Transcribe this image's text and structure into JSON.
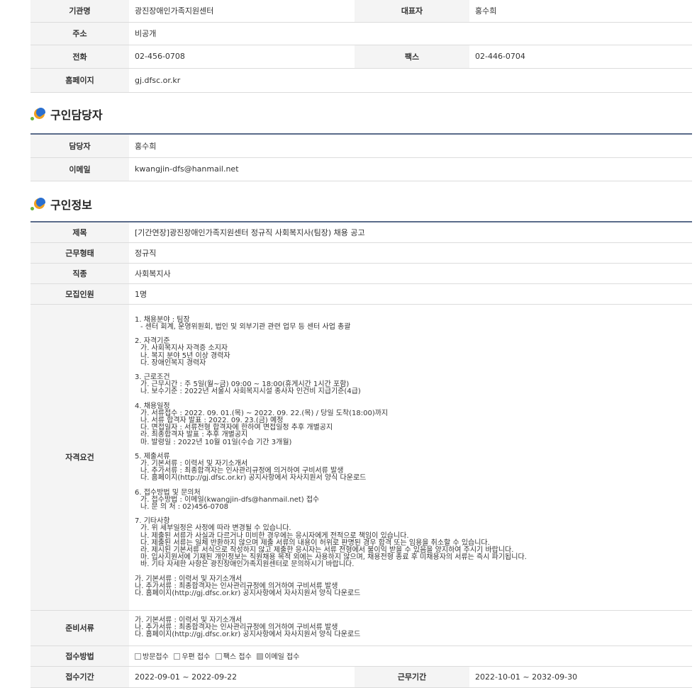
{
  "org": {
    "rows": [
      {
        "label": "기관명",
        "value": "광진장애인가족지원센터",
        "label2": "대표자",
        "value2": "홍수희"
      },
      {
        "label": "주소",
        "value": "비공개"
      },
      {
        "label": "전화",
        "value": "02-456-0708",
        "label2": "팩스",
        "value2": "02-446-0704"
      },
      {
        "label": "홈페이지",
        "value": "gj.dfsc.or.kr"
      }
    ]
  },
  "contact": {
    "section_title": "구인담당자",
    "rows": [
      {
        "label": "담당자",
        "value": "홍수희"
      },
      {
        "label": "이메일",
        "value": "kwangjin-dfs@hanmail.net"
      }
    ]
  },
  "job": {
    "section_title": "구인정보",
    "title_label": "제목",
    "title_value": "[기간연장]광진장애인가족지원센터 정규직 사회복지사(팀장) 채용 공고",
    "type_label": "근무형태",
    "type_value": "정규직",
    "kind_label": "직종",
    "kind_value": "사회복지사",
    "count_label": "모집인원",
    "count_value": "1명",
    "req_label": "자격요건",
    "requirements": [
      {
        "lines": [
          "1. 채용분야 : 팀장",
          "- 센터 회계, 운영위원회, 법인 및 외부기관 관련 업무 등 센터 사업 총괄"
        ]
      },
      {
        "lines": [
          "2. 자격기준",
          "가. 사회복지사 자격증 소지자",
          "나. 복지 분야 5년 이상 경력자",
          "다. 장애인복지 경력자"
        ]
      },
      {
        "lines": [
          "3. 근로조건",
          "가. 근무시간 : 주 5일(월~금) 09:00 ~ 18:00(휴게시간 1시간 포함)",
          "나. 보수기준 : 2022년 서울시 사회복지시설 종사자 인건비 지급기준(4급)"
        ]
      },
      {
        "lines": [
          "4. 채용일정",
          "가. 서류접수 : 2022. 09. 01.(목) ~ 2022. 09. 22.(목) / 당일 도착(18:00)까지",
          "나. 서류 합격자 발표 : 2022. 09. 23.(금) 예정",
          "다. 면접일자 : 서류전형 합격자에 한하여 면접일정 추후 개별공지",
          "라. 최종합격자 발표 : 추후 개별공지",
          "마. 발령일 : 2022년 10월 01일(수습 기간 3개월)"
        ]
      },
      {
        "lines": [
          "5. 제출서류",
          "가. 기본서류 : 이력서 및 자기소개서",
          "나. 추가서류 : 최종합격자는 인사관리규정에 의거하여 구비서류 발생",
          "다. 홈페이지(http://gj.dfsc.or.kr) 공지사항에서 자사지원서 양식 다운로드"
        ]
      },
      {
        "lines": [
          "6. 접수방법 및 문의처",
          "가. 접수방법 : 이메일(kwangjin-dfs@hanmail.net) 접수",
          "나. 문 의 처 : 02)456-0708"
        ]
      },
      {
        "lines": [
          "7. 기타사항",
          "가.  위 세부일정은 사정에 따라 변경될 수 있습니다.",
          "나. 제출된 서류가 사실과 다르거나 미비한 경우에는 응시자에게 전적으로  책임이 있습니다.",
          "다. 제출된 서류는 일체 반환하지 않으며 제출 서류의 내용이 허위로 판명된  경우 합격 또는 임용을 취소할 수 있습니다.",
          "라. 제시된 기본서류 서식으로 작성하지 않고 제출한 응시자는 서류 전형에서  불이익 받을 수 있음을 양지하여 주시기 바랍니다.",
          "마. 입사지원서에 기재된 개인정보는 직원채용 목적 외에는 사용하지 않으며, 채용전형 종료 후 미채용자의 서류는 즉시 파기됩니다.",
          "바. 기타 자세한 사항은 광진장애인가족지원센터로 문의하시기 바랍니다."
        ]
      },
      {
        "lines": [
          "가. 기본서류 : 이력서 및 자기소개서",
          "나. 추가서류 : 최종합격자는 인사관리규정에 의거하여 구비서류 발생",
          "다. 홈페이지(http://gj.dfsc.or.kr) 공지사항에서 자사지원서 양식 다운로드"
        ]
      }
    ],
    "docs_label": "준비서류",
    "docs_lines": [
      "가. 기본서류 : 이력서 및 자기소개서",
      "나. 추가서류 : 최종합격자는 인사관리규정에 의거하여 구비서류 발생",
      "다. 홈페이지(http://gj.dfsc.or.kr) 공지사항에서 자사지원서 양식 다운로드"
    ],
    "method_label": "접수방법",
    "methods": [
      {
        "label": "방문접수",
        "checked": false
      },
      {
        "label": "우편 접수",
        "checked": false
      },
      {
        "label": "팩스 접수",
        "checked": false
      },
      {
        "label": "이메일 접수",
        "checked": true
      }
    ],
    "period_label": "접수기간",
    "period_value": "2022-09-01 ~ 2022-09-22",
    "work_label": "근무기간",
    "work_value": "2022-10-01 ~ 2032-09-30"
  }
}
